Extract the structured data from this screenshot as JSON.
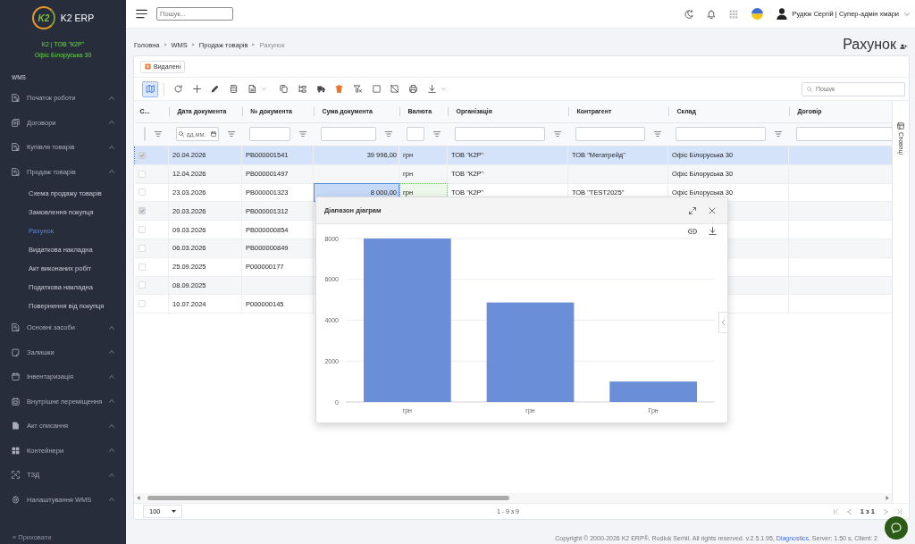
{
  "sidebar": {
    "logo_mark": "K2",
    "brand": "K2 ERP",
    "org_lines": [
      "К2 | ТОВ \"К2Р\"",
      "Офіс Білоруська 30"
    ],
    "section": "WMS",
    "items": [
      {
        "label": "Початок роботи",
        "selected": false
      },
      {
        "label": "Договори",
        "selected": false
      },
      {
        "label": "Купівля товарів",
        "selected": false
      },
      {
        "label": "Продаж товарів",
        "selected": false,
        "children": [
          {
            "label": "Схема продажу товарів",
            "selected": false
          },
          {
            "label": "Замовлення покупця",
            "selected": false
          },
          {
            "label": "Рахунок",
            "selected": true
          },
          {
            "label": "Видаткова накладна",
            "selected": false
          },
          {
            "label": "Акт виконаних робіт",
            "selected": false
          },
          {
            "label": "Податкова накладна",
            "selected": false
          },
          {
            "label": "Повернення від покупця",
            "selected": false
          }
        ]
      },
      {
        "label": "Основні засоби",
        "selected": false
      },
      {
        "label": "Залишки",
        "selected": false
      },
      {
        "label": "Інвентаризація",
        "selected": false
      },
      {
        "label": "Внутрішнє переміщення",
        "selected": false
      },
      {
        "label": "Акт списання",
        "selected": false
      },
      {
        "label": "Контейнери",
        "selected": false
      },
      {
        "label": "ТЗД",
        "selected": false
      },
      {
        "label": "Налаштування WMS",
        "selected": false
      }
    ],
    "collapse": "« Приховати"
  },
  "topbar": {
    "search": {
      "placeholder": "Пошук..."
    },
    "user": "Рудюк Сергій | Супер-адмін хмари"
  },
  "breadcrumbs": [
    {
      "label": "Головна",
      "current": false
    },
    {
      "label": "WMS",
      "current": false
    },
    {
      "label": "Продаж товарів",
      "current": false
    },
    {
      "label": "Рахунок",
      "current": true
    }
  ],
  "page_title": "Рахунок",
  "deleted_button": "Видалені",
  "toolbar": {
    "buttons": [
      {
        "kind": "map",
        "on": true,
        "menu": false
      },
      {
        "kind": "separator"
      },
      {
        "kind": "refresh",
        "on": false,
        "menu": false
      },
      {
        "kind": "add",
        "on": false,
        "menu": false
      },
      {
        "kind": "edit",
        "on": false,
        "menu": false
      },
      {
        "kind": "calculator",
        "on": false,
        "menu": false
      },
      {
        "kind": "document",
        "on": false,
        "menu": true
      },
      {
        "kind": "copy",
        "on": false,
        "menu": false
      },
      {
        "kind": "tree",
        "on": false,
        "menu": false
      },
      {
        "kind": "truck",
        "on": false,
        "menu": false
      },
      {
        "kind": "delete",
        "on": false,
        "menu": false
      },
      {
        "kind": "clear_filter",
        "on": false,
        "menu": false
      },
      {
        "kind": "select",
        "on": false,
        "menu": false
      },
      {
        "kind": "deselect",
        "on": false,
        "menu": false
      },
      {
        "kind": "print",
        "on": false,
        "menu": false
      },
      {
        "kind": "download",
        "on": false,
        "menu": true
      }
    ],
    "search": {
      "placeholder": "Пошук"
    }
  },
  "table": {
    "columns": [
      {
        "label": "С...",
        "kind": "check",
        "filter_button": true
      },
      {
        "label": "Дата документа",
        "kind": "date",
        "filter_placeholder": "дд.мм.",
        "filter_button": true
      },
      {
        "label": "№ документа",
        "kind": "text",
        "filter_button": true
      },
      {
        "label": "Сума документа",
        "kind": "text",
        "filter_button": true
      },
      {
        "label": "Валюта",
        "kind": "text",
        "filter_button": true
      },
      {
        "label": "Організація",
        "kind": "text",
        "filter_button": true
      },
      {
        "label": "Контрагент",
        "kind": "text",
        "filter_button": true
      },
      {
        "label": "Склад",
        "kind": "text",
        "filter_button": true
      },
      {
        "label": "Договір",
        "kind": "text",
        "filter_button": false
      }
    ],
    "rows": [
      {
        "checked": true,
        "selected": true,
        "in_chart_range": false,
        "date": "20.04.2026",
        "number": "PB000001541",
        "amount": "39 996,00",
        "currency": "грн",
        "organization": "ТОВ \"К2Р\"",
        "counterparty": "ТОВ \"Мегатрейд\"",
        "warehouse": "Офіс Білоруська 30"
      },
      {
        "checked": false,
        "selected": false,
        "in_chart_range": false,
        "date": "12.04.2026",
        "number": "PB000001497",
        "currency": "грн",
        "organization": "ТОВ \"К2Р\"",
        "warehouse": "Офіс Білоруська 30"
      },
      {
        "checked": false,
        "selected": false,
        "in_chart_range": true,
        "date": "23.03.2026",
        "number": "PB000001323",
        "amount": "8 000,00",
        "currency": "грн",
        "organization": "ТОВ \"К2Р\"",
        "counterparty": "ТОВ \"TEST2025\"",
        "warehouse": "Офіс Білоруська 30"
      },
      {
        "checked": true,
        "selected": false,
        "in_chart_range": false,
        "date": "20.03.2026",
        "number": "PB000001312"
      },
      {
        "checked": false,
        "selected": false,
        "in_chart_range": false,
        "date": "09.03.2026",
        "number": "PB000000854"
      },
      {
        "checked": false,
        "selected": false,
        "in_chart_range": false,
        "date": "06.03.2026",
        "number": "PB000000849"
      },
      {
        "checked": false,
        "selected": false,
        "in_chart_range": false,
        "date": "25.09.2025",
        "number": "P000000177"
      },
      {
        "checked": false,
        "selected": false,
        "in_chart_range": false,
        "date": "08.09.2025"
      },
      {
        "checked": false,
        "selected": false,
        "in_chart_range": false,
        "date": "10.07.2024",
        "number": "P000000145"
      }
    ]
  },
  "columns_panel": "Стовпці",
  "pager": {
    "page_size": "100",
    "range": "1 - 9 з 9",
    "page": "1 з 1"
  },
  "footer": {
    "text": "Copyright © 2000-2026 K2 ERP®, Rudiuk Serhii. All rights reserved. v.2.5.1.95, ",
    "link": "Diagnostics",
    "text_after": ", Server: 1.50 s, Client: 2"
  },
  "chart_popup": {
    "title": "Діапазон діаграм",
    "chart_data": {
      "type": "bar",
      "categories": [
        "грн",
        "грн",
        "Грн"
      ],
      "values": [
        8000,
        4870,
        1000
      ],
      "ylim": [
        0,
        8000
      ],
      "yticks": [
        0,
        2000,
        4000,
        6000,
        8000
      ],
      "grid": true
    }
  }
}
